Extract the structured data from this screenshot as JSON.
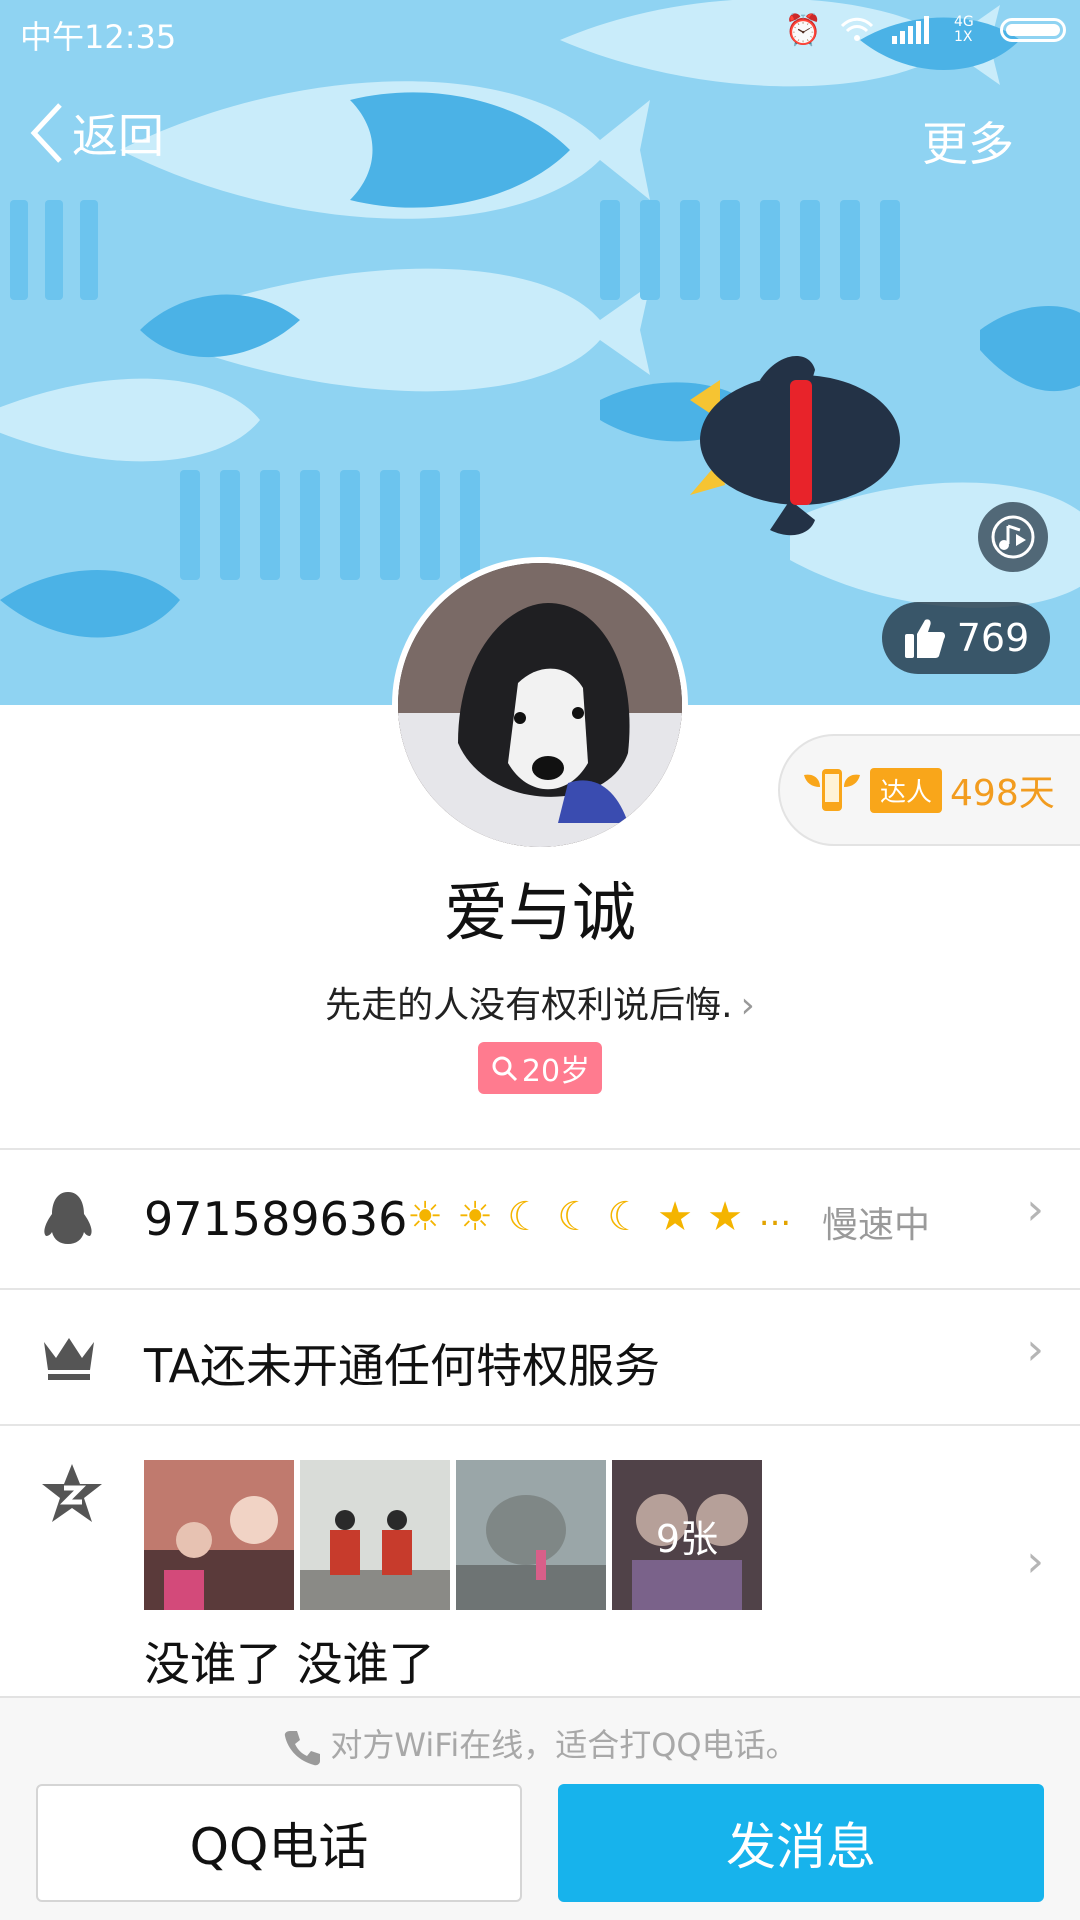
{
  "status_bar": {
    "time": "中午12:35",
    "network": "4G\n1X"
  },
  "nav": {
    "back_label": "返回",
    "more_label": "更多"
  },
  "cover": {
    "like_count": "769"
  },
  "badge": {
    "daren_label": "达人",
    "days": "498天"
  },
  "profile": {
    "nickname": "爱与诚",
    "signature": "先走的人没有权利说后悔.",
    "age": "20岁"
  },
  "qq_row": {
    "qq_number": "971589636",
    "level_icons": [
      "sun-icon",
      "sun-icon",
      "moon-icon",
      "moon-icon",
      "moon-icon",
      "star-icon",
      "star-icon"
    ],
    "level_more": "...",
    "speed_status": "慢速中"
  },
  "privilege_row": {
    "text": "TA还未开通任何特权服务"
  },
  "qzone_row": {
    "photo_count": "9张",
    "mood_text": "没谁了 没谁了"
  },
  "bottom_bar": {
    "wifi_tip": "对方WiFi在线，适合打QQ电话。",
    "call_button": "QQ电话",
    "message_button": "发消息"
  },
  "colors": {
    "accent": "#17b3ec",
    "age_tag": "#ff7b8f",
    "daren_orange": "#f9a61a",
    "cover_bg": "#8fd3f2"
  }
}
